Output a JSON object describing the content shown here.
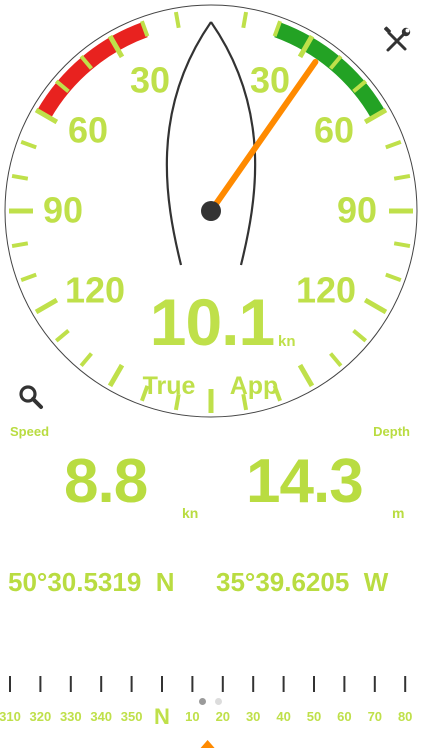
{
  "colors": {
    "accent": "#bfe04a",
    "red_zone": "#e8221f",
    "green_zone": "#23a224",
    "needle": "#ff8a00",
    "hull": "#333333",
    "icon": "#333333"
  },
  "wind": {
    "apparent_angle_deg": 35,
    "speed_value": "10.1",
    "speed_unit": "kn",
    "mode_true_label": "True",
    "mode_app_label": "App",
    "angle_labels": {
      "left_30": "30",
      "left_60": "60",
      "left_90": "90",
      "left_120": "120",
      "right_30": "30",
      "right_60": "60",
      "right_90": "90",
      "right_120": "120"
    }
  },
  "icons": {
    "settings": "tools-icon",
    "search": "magnifier-icon"
  },
  "speed": {
    "label": "Speed",
    "value": "8.8",
    "unit": "kn"
  },
  "depth": {
    "label": "Depth",
    "value": "14.3",
    "unit": "m"
  },
  "position": {
    "latitude": "50°30.5319  N",
    "longitude": "35°39.6205  W"
  },
  "pager": {
    "pages": 2,
    "active_index": 0
  },
  "compass": {
    "heading_deg": 15,
    "labels": [
      "310",
      "320",
      "330",
      "340",
      "350",
      "N",
      "10",
      "20",
      "30",
      "40",
      "50",
      "60",
      "70",
      "80"
    ]
  }
}
